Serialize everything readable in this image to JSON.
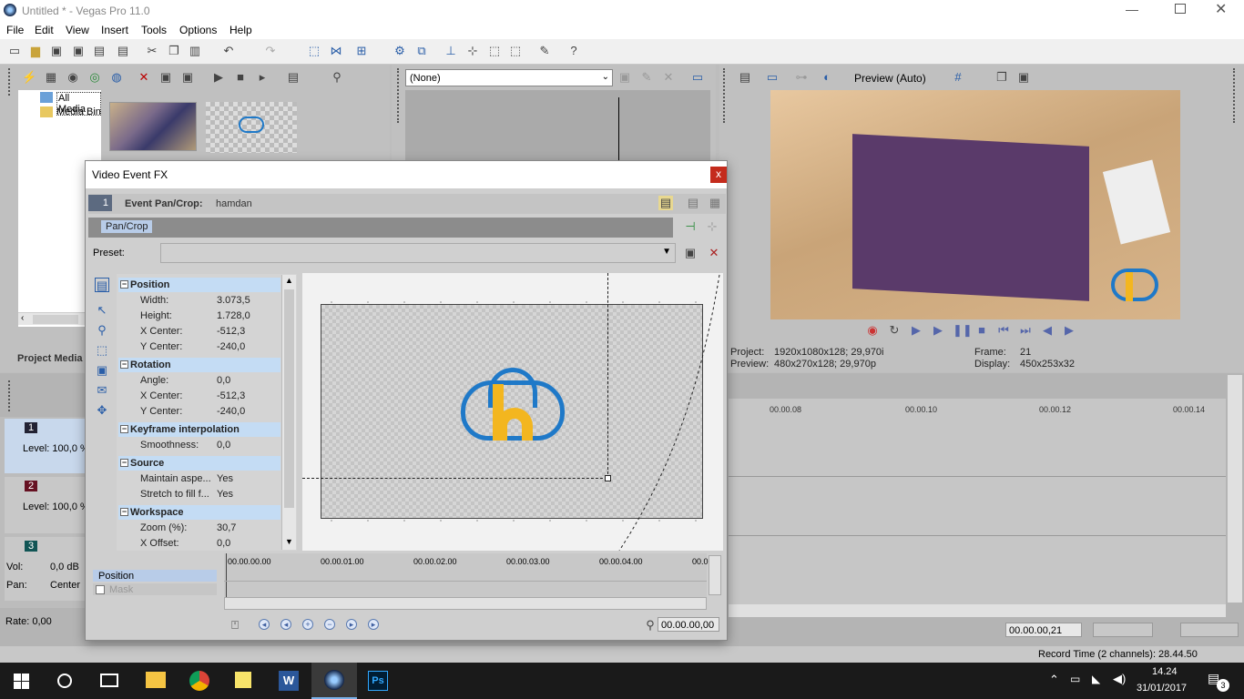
{
  "window": {
    "title": "Untitled * - Vegas Pro 11.0"
  },
  "menu": [
    "File",
    "Edit",
    "View",
    "Insert",
    "Tools",
    "Options",
    "Help"
  ],
  "explorer": {
    "items": [
      "All Media",
      "Media Bin"
    ],
    "panel_label": "Project Media"
  },
  "trimmer": {
    "select_value": "(None)"
  },
  "preview": {
    "mode": "Preview (Auto)",
    "project_label": "Project:",
    "project_value": "1920x1080x128; 29,970i",
    "preview_label": "Preview:",
    "preview_value": "480x270x128; 29,970p",
    "frame_label": "Frame:",
    "frame_value": "21",
    "display_label": "Display:",
    "display_value": "450x253x32"
  },
  "timeline": {
    "ruler": [
      "00.00.08",
      "00.00.10",
      "00.00.12",
      "00.00.14"
    ],
    "tracks": [
      {
        "num": "1",
        "level": "Level: 100,0 %"
      },
      {
        "num": "2",
        "level": "Level: 100,0 %"
      },
      {
        "num": "3",
        "vol_label": "Vol:",
        "vol": "0,0 dB",
        "pan_label": "Pan:",
        "pan": "Center"
      }
    ],
    "rate": "Rate: 0,00",
    "cursor_time": "00.00.00,21",
    "record_time": "Record Time (2 channels): 28.44.50"
  },
  "dialog": {
    "title": "Video Event FX",
    "close": "x",
    "chain_num": "1",
    "event_label": "Event Pan/Crop:",
    "event_name": "hamdan",
    "plugin": "Pan/Crop",
    "preset_label": "Preset:",
    "sections": [
      {
        "name": "Position",
        "rows": [
          [
            "Width:",
            "3.073,5"
          ],
          [
            "Height:",
            "1.728,0"
          ],
          [
            "X Center:",
            "-512,3"
          ],
          [
            "Y Center:",
            "-240,0"
          ]
        ]
      },
      {
        "name": "Rotation",
        "rows": [
          [
            "Angle:",
            "0,0"
          ],
          [
            "X Center:",
            "-512,3"
          ],
          [
            "Y Center:",
            "-240,0"
          ]
        ]
      },
      {
        "name": "Keyframe interpolation",
        "rows": [
          [
            "Smoothness:",
            "0,0"
          ]
        ]
      },
      {
        "name": "Source",
        "rows": [
          [
            "Maintain aspe...",
            "Yes"
          ],
          [
            "Stretch to fill f...",
            "Yes"
          ]
        ]
      },
      {
        "name": "Workspace",
        "rows": [
          [
            "Zoom (%):",
            "30,7"
          ],
          [
            "X Offset:",
            "0,0"
          ]
        ]
      }
    ],
    "kf_ruler": [
      "00.00.00.00",
      "00.00.01.00",
      "00.00.02.00",
      "00.00.03.00",
      "00.00.04.00",
      "00.0"
    ],
    "kf_tracks": [
      "Position",
      "Mask"
    ],
    "kf_time": "00.00.00,00"
  },
  "taskbar": {
    "time": "14.24",
    "date": "31/01/2017",
    "notif_count": "3"
  },
  "colors": {
    "accent": "#1f6fc4",
    "logo_blue": "#1f79c8",
    "logo_yellow": "#f3b61f",
    "section_bg": "#c4dcf4"
  }
}
